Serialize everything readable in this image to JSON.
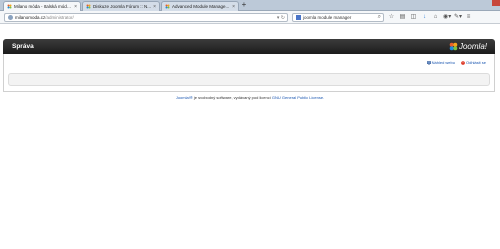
{
  "browser": {
    "tabs": [
      {
        "label": "Milano móda - Italská módní ...",
        "active": true
      },
      {
        "label": "Diskuze Joomla Fórum :: N...",
        "active": false
      },
      {
        "label": "Advanced Module Manage...",
        "active": false
      }
    ],
    "new_tab_label": "+",
    "url_host": "milanomoda.cz",
    "url_path": "/administrator/",
    "search_text": "joomla module manager"
  },
  "joomla": {
    "header_title": "Správa",
    "logo_text": "Joomla!",
    "links": {
      "view_site": "Náhled webu",
      "logout": "Odhlásit se"
    },
    "footer": {
      "brand": "Joomla!®",
      "text": " je svobodný software, vydávaný pod licencí ",
      "license": "GNU General Public License."
    }
  },
  "colors": {
    "header_dark": "#1c1c1c",
    "link_blue": "#1b57b1",
    "logout_red": "#d9230f"
  }
}
